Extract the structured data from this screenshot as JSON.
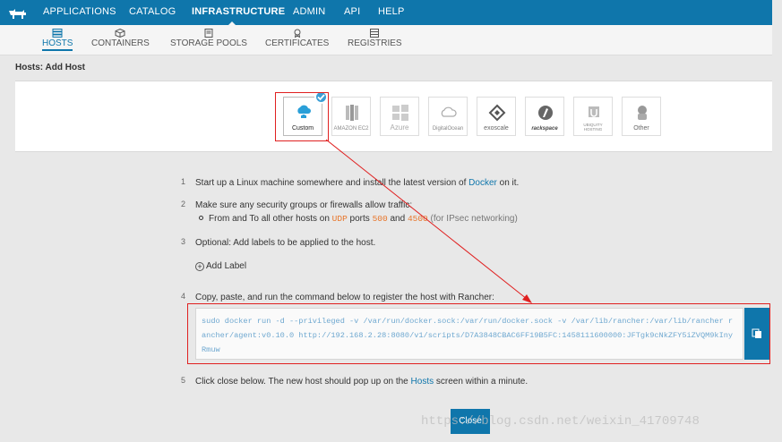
{
  "topnav": {
    "items": [
      "APPLICATIONS",
      "CATALOG",
      "INFRASTRUCTURE",
      "ADMIN",
      "API",
      "HELP"
    ],
    "active": "INFRASTRUCTURE"
  },
  "subnav": {
    "items": [
      "HOSTS",
      "CONTAINERS",
      "STORAGE POOLS",
      "CERTIFICATES",
      "REGISTRIES"
    ],
    "active": "HOSTS"
  },
  "page": {
    "title": "Hosts: Add Host"
  },
  "drivers": [
    "Custom",
    "AMAZON EC2",
    "Azure",
    "DigitalOcean",
    "exoscale",
    "rackspace",
    "UBIQUITY HOSTING",
    "Other"
  ],
  "steps": {
    "s1": {
      "num": "1",
      "pre": "Start up a Linux machine somewhere and install the latest version of ",
      "link": "Docker",
      "post": " on it."
    },
    "s2": {
      "num": "2",
      "text": "Make sure any security groups or firewalls allow traffic:",
      "bullet_pre": "From and To all other hosts on ",
      "proto": "UDP",
      "mid1": " ports ",
      "port1": "500",
      "mid2": " and ",
      "port2": "4500",
      "post": " (for IPsec networking)"
    },
    "s3": {
      "num": "3",
      "text": "Optional: Add labels to be applied to the host.",
      "add_label": "Add Label"
    },
    "s4": {
      "num": "4",
      "text": "Copy, paste, and run the command below to register the host with Rancher:",
      "command": "sudo docker run -d --privileged -v /var/run/docker.sock:/var/run/docker.sock -v /var/lib/rancher:/var/lib/rancher rancher/agent:v0.10.0 http://192.168.2.28:8080/v1/scripts/D7A3848CBAC6FF19B5FC:1458111600000:JFTgk9cNkZFY5iZVQM9kInyRmuw"
    },
    "s5": {
      "num": "5",
      "pre": "Click close below. The new host should pop up on the ",
      "link": "Hosts",
      "post": " screen within a minute."
    }
  },
  "close_label": "Close",
  "watermark": "https://blog.csdn.net/weixin_41709748",
  "colors": {
    "brand": "#0f76ab",
    "highlight": "#e02020",
    "accent": "#e8762b"
  }
}
